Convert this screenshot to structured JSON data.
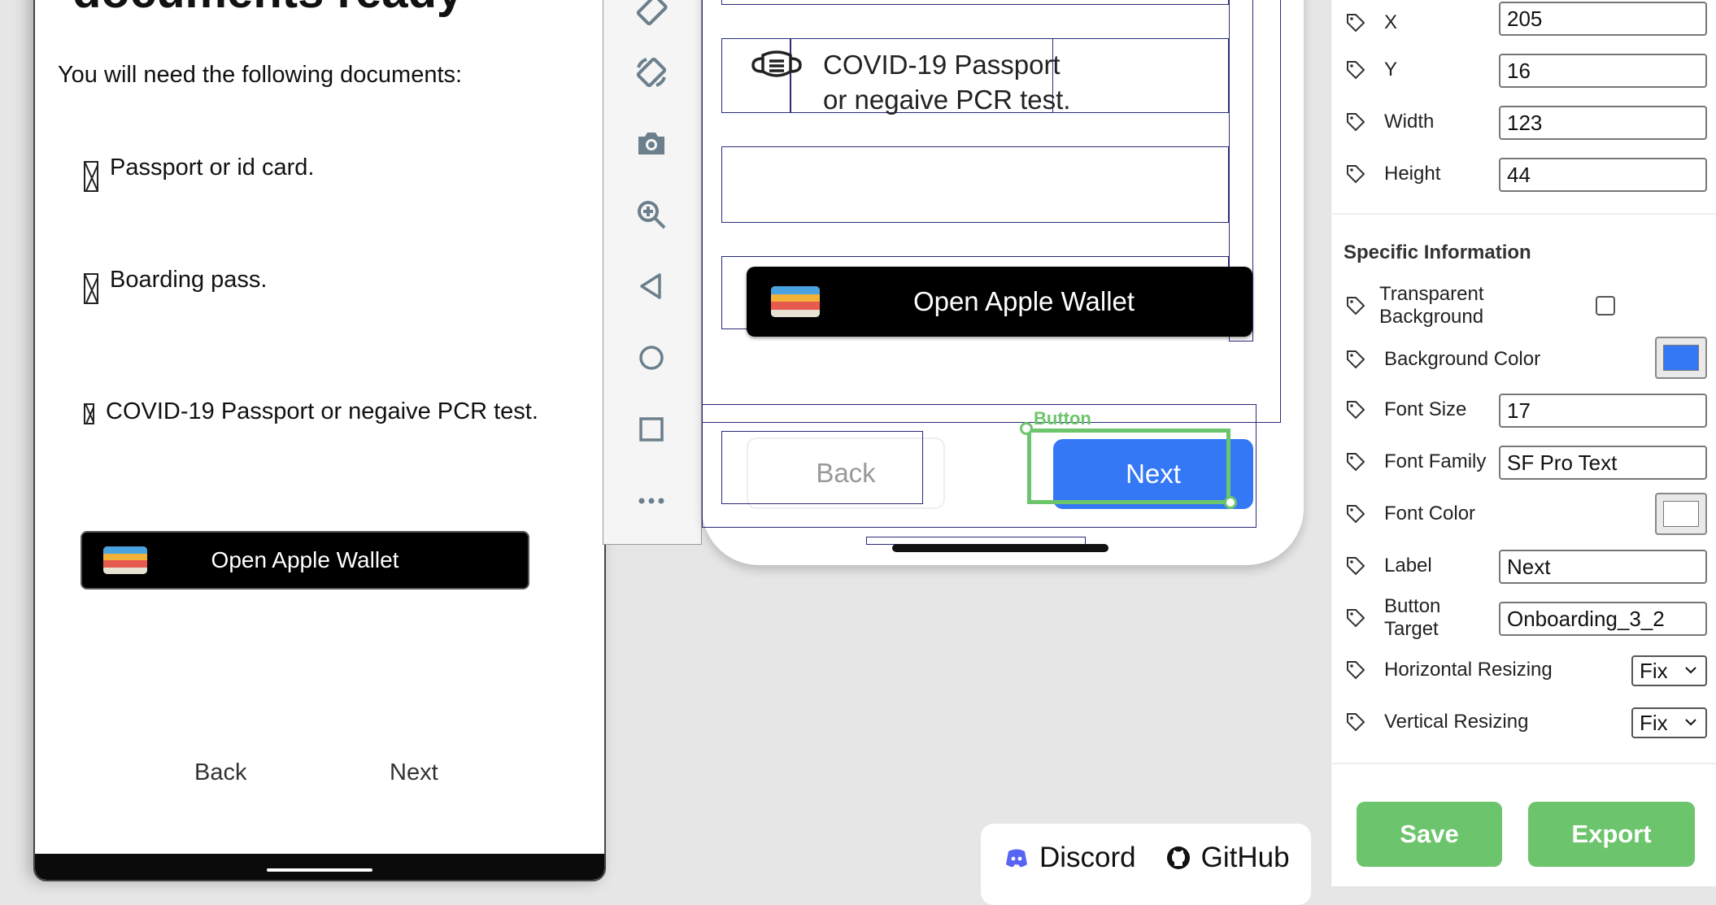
{
  "preview": {
    "title": "documents ready",
    "subtitle": "You will need the following documents:",
    "documents": [
      "Passport or id card.",
      "Boarding pass.",
      "COVID-19 Passport  or negaive PCR test."
    ],
    "wallet_label": "Open Apple Wallet",
    "back_label": "Back",
    "next_label": "Next"
  },
  "canvas": {
    "covid_line1": "COVID-19 Passport",
    "covid_line2": "or negaive PCR test.",
    "wallet_label": "Open Apple Wallet",
    "back_label": "Back",
    "next_label": "Next",
    "selection_label": "Button"
  },
  "footer": {
    "discord_label": "Discord",
    "github_label": "GitHub"
  },
  "panel": {
    "x_label": "X",
    "x_value": "205",
    "y_label": "Y",
    "y_value": "16",
    "width_label": "Width",
    "width_value": "123",
    "height_label": "Height",
    "height_value": "44",
    "section_title": "Specific Information",
    "transparent_label_1": "Transparent",
    "transparent_label_2": "Background",
    "bg_color_label": "Background Color",
    "bg_color_value": "#3478f6",
    "font_size_label": "Font Size",
    "font_size_value": "17",
    "font_family_label": "Font Family",
    "font_family_value": "SF Pro Text",
    "font_color_label": "Font Color",
    "font_color_value": "#ffffff",
    "label_label": "Label",
    "label_value": "Next",
    "button_target_label_1": "Button",
    "button_target_label_2": "Target",
    "button_target_value": "Onboarding_3_2",
    "h_resize_label": "Horizontal Resizing",
    "h_resize_value": "Fix",
    "v_resize_label": "Vertical Resizing",
    "v_resize_value": "Fix",
    "save_label": "Save",
    "export_label": "Export"
  },
  "colors": {
    "accent_blue": "#3478f6",
    "selection_green": "#6cc56c",
    "outline_navy": "#2a2a7a"
  }
}
